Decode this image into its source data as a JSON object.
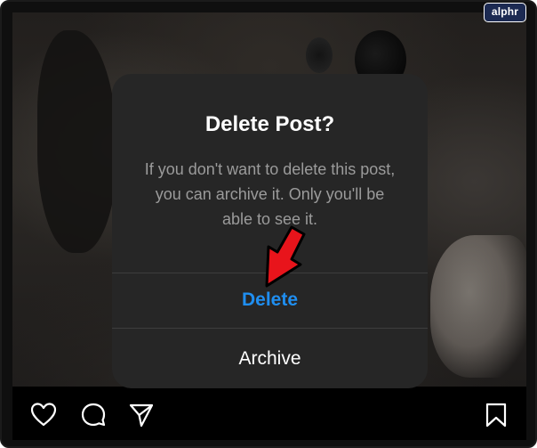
{
  "watermark": {
    "text": "alphr"
  },
  "dialog": {
    "title": "Delete Post?",
    "message": "If you don't want to delete this post, you can archive it. Only you'll be able to see it.",
    "buttons": {
      "delete_label": "Delete",
      "archive_label": "Archive"
    }
  },
  "colors": {
    "delete_accent": "#1f8ef0",
    "dialog_bg": "#262626",
    "arrow_red": "#e8141b"
  },
  "icons": {
    "bottom_bar": [
      "heart-icon",
      "comment-icon",
      "share-icon",
      "bookmark-icon"
    ],
    "annotation": "red-arrow-icon"
  }
}
